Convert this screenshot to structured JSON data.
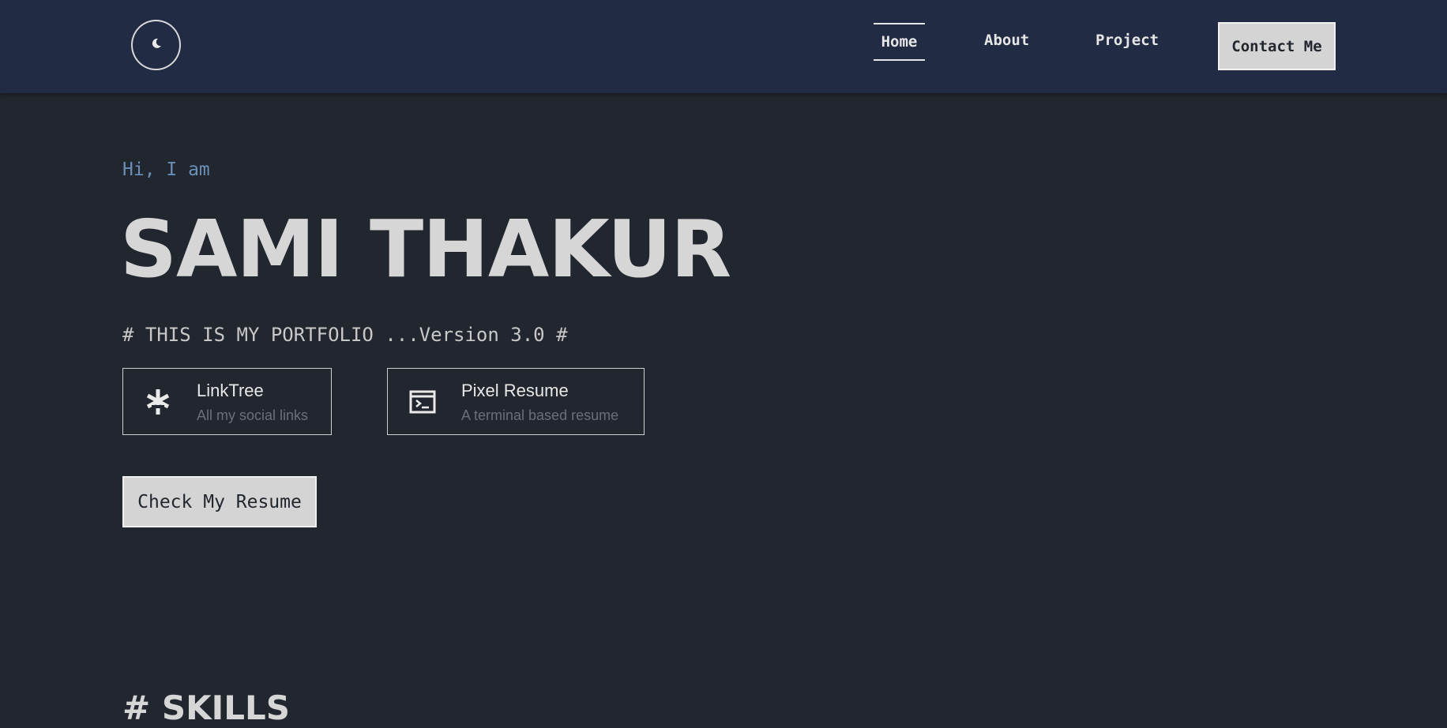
{
  "header": {
    "theme_toggle_icon": "moon-icon",
    "nav": {
      "home": "Home",
      "about": "About",
      "project": "Project"
    },
    "contact_label": "Contact Me"
  },
  "hero": {
    "greeting": "Hi, I am",
    "name": "SAMI THAKUR",
    "tagline": "# THIS IS MY PORTFOLIO ...Version 3.0 #"
  },
  "cards": [
    {
      "icon": "linktree-asterisk-icon",
      "title": "LinkTree",
      "subtitle": "All my social links"
    },
    {
      "icon": "terminal-icon",
      "title": "Pixel Resume",
      "subtitle": "A terminal based resume"
    }
  ],
  "resume_button": "Check My Resume",
  "skills_heading": "# SKILLS",
  "colors": {
    "page_bg": "#22262e",
    "header_bg": "#222b44",
    "greeting": "#6a8fb8",
    "text": "#d6d6d6",
    "muted": "#6b6f78",
    "button_bg": "#d4d4d4"
  }
}
